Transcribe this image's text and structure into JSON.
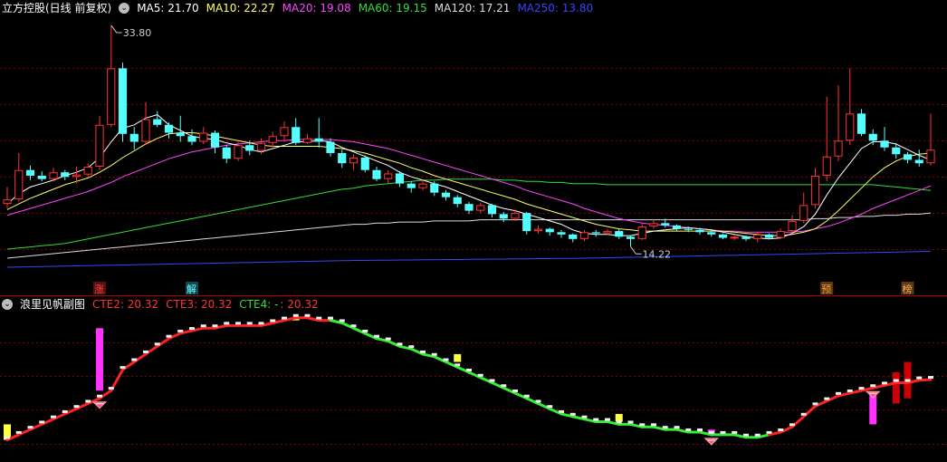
{
  "main_chart": {
    "title": "立方控股(日线 前复权)",
    "indicators": [
      {
        "label": "MA5: 21.70",
        "color": "#ffffff"
      },
      {
        "label": "MA10: 22.27",
        "color": "#ffff66"
      },
      {
        "label": "MA20: 19.08",
        "color": "#ff44ff"
      },
      {
        "label": "MA60: 19.15",
        "color": "#33dd33"
      },
      {
        "label": "MA120: 17.21",
        "color": "#dddddd"
      },
      {
        "label": "MA250: 13.80",
        "color": "#3344ff"
      }
    ],
    "high_label": "33.80",
    "low_label": "14.22",
    "markers": [
      "涨",
      "解",
      "预",
      "榜"
    ]
  },
  "sub_chart": {
    "title": "浪里见帆副图",
    "indicators": [
      {
        "label": "CTE2: 20.32",
        "color": "#ff3333"
      },
      {
        "label": "CTE3: 20.32",
        "color": "#ff3333"
      },
      {
        "label": "CTE4: -",
        "color": "#33dd33"
      },
      {
        "label": ": 20.32",
        "color": "#ff3333"
      }
    ]
  },
  "colors": {
    "up": "#ff3333",
    "down": "#54ffff",
    "grid": "#8b0000",
    "background": "#000000"
  },
  "chart_data": {
    "type": "candlestick",
    "candles": [
      [
        18.0,
        18.4,
        17.6,
        19.5
      ],
      [
        18.4,
        21.0,
        18.2,
        22.5
      ],
      [
        21.0,
        20.5,
        20.1,
        21.4
      ],
      [
        20.5,
        20.2,
        20.0,
        20.9
      ],
      [
        20.2,
        20.8,
        20.0,
        21.2
      ],
      [
        20.8,
        20.4,
        20.1,
        21.0
      ],
      [
        20.4,
        20.6,
        19.8,
        21.3
      ],
      [
        20.6,
        21.3,
        20.4,
        21.6
      ],
      [
        21.3,
        25.0,
        21.0,
        25.8
      ],
      [
        25.0,
        30.0,
        24.8,
        33.8
      ],
      [
        30.0,
        24.2,
        23.5,
        30.5
      ],
      [
        24.2,
        23.5,
        22.8,
        24.8
      ],
      [
        23.5,
        25.5,
        23.2,
        27.0
      ],
      [
        25.5,
        25.0,
        24.8,
        26.2
      ],
      [
        25.0,
        24.3,
        23.8,
        25.2
      ],
      [
        24.3,
        24.0,
        23.5,
        25.8
      ],
      [
        24.0,
        23.5,
        23.2,
        24.6
      ],
      [
        23.5,
        24.3,
        23.3,
        24.8
      ],
      [
        24.3,
        23.0,
        22.5,
        24.5
      ],
      [
        23.0,
        22.0,
        21.6,
        23.2
      ],
      [
        22.0,
        23.2,
        21.8,
        23.5
      ],
      [
        23.2,
        22.7,
        22.3,
        23.6
      ],
      [
        22.7,
        23.4,
        22.4,
        23.8
      ],
      [
        23.4,
        24.0,
        23.0,
        24.4
      ],
      [
        24.0,
        24.8,
        23.5,
        25.3
      ],
      [
        24.8,
        23.4,
        23.2,
        25.6
      ],
      [
        23.4,
        23.8,
        23.3,
        24.2
      ],
      [
        23.8,
        23.5,
        23.0,
        25.6
      ],
      [
        23.5,
        22.5,
        22.2,
        23.8
      ],
      [
        22.5,
        21.6,
        21.2,
        22.8
      ],
      [
        21.6,
        22.1,
        21.0,
        22.4
      ],
      [
        22.1,
        21.0,
        20.8,
        22.3
      ],
      [
        21.0,
        20.2,
        20.0,
        21.3
      ],
      [
        20.2,
        20.7,
        19.8,
        21.0
      ],
      [
        20.7,
        19.8,
        19.5,
        20.9
      ],
      [
        19.8,
        19.4,
        19.0,
        20.0
      ],
      [
        19.4,
        19.8,
        19.2,
        20.1
      ],
      [
        19.8,
        19.0,
        18.7,
        20.0
      ],
      [
        19.0,
        18.6,
        18.3,
        19.2
      ],
      [
        18.6,
        18.0,
        17.7,
        18.8
      ],
      [
        18.0,
        17.4,
        17.1,
        18.2
      ],
      [
        17.4,
        17.9,
        17.2,
        18.1
      ],
      [
        17.9,
        17.1,
        16.8,
        18.0
      ],
      [
        17.1,
        16.7,
        16.4,
        17.3
      ],
      [
        16.7,
        17.2,
        16.5,
        17.5
      ],
      [
        17.2,
        15.6,
        15.3,
        17.3
      ],
      [
        15.6,
        15.8,
        15.4,
        16.1
      ],
      [
        15.8,
        15.5,
        15.2,
        15.9
      ],
      [
        15.5,
        15.3,
        15.0,
        15.7
      ],
      [
        15.3,
        14.9,
        14.6,
        15.4
      ],
      [
        14.9,
        15.5,
        14.7,
        15.7
      ],
      [
        15.5,
        15.4,
        15.1,
        15.7
      ],
      [
        15.4,
        15.6,
        15.3,
        15.8
      ],
      [
        15.6,
        15.1,
        14.9,
        15.8
      ],
      [
        15.1,
        14.9,
        14.22,
        15.2
      ],
      [
        14.9,
        16.0,
        14.8,
        16.3
      ],
      [
        16.0,
        16.3,
        15.8,
        16.6
      ],
      [
        16.3,
        16.1,
        15.9,
        16.7
      ],
      [
        16.1,
        15.8,
        15.6,
        16.2
      ],
      [
        15.8,
        15.7,
        15.5,
        16.0
      ],
      [
        15.7,
        15.5,
        15.3,
        15.9
      ],
      [
        15.5,
        15.3,
        15.1,
        15.7
      ],
      [
        15.3,
        15.0,
        14.9,
        15.4
      ],
      [
        15.0,
        15.1,
        14.8,
        15.3
      ],
      [
        15.1,
        14.9,
        14.7,
        15.2
      ],
      [
        14.9,
        15.3,
        14.6,
        15.5
      ],
      [
        15.3,
        15.0,
        14.9,
        15.4
      ],
      [
        15.0,
        15.6,
        14.9,
        15.8
      ],
      [
        15.6,
        16.5,
        15.4,
        17.0
      ],
      [
        16.5,
        17.9,
        16.3,
        19.0
      ],
      [
        17.9,
        20.5,
        17.6,
        21.2
      ],
      [
        20.5,
        22.2,
        20.0,
        27.5
      ],
      [
        22.2,
        23.6,
        21.8,
        28.5
      ],
      [
        23.6,
        26.0,
        23.2,
        30.0
      ],
      [
        26.0,
        24.2,
        24.0,
        26.4
      ],
      [
        24.2,
        23.6,
        23.2,
        24.6
      ],
      [
        23.6,
        23.0,
        22.7,
        24.8
      ],
      [
        23.0,
        22.4,
        22.0,
        23.4
      ],
      [
        22.4,
        21.9,
        21.6,
        22.6
      ],
      [
        21.9,
        21.6,
        21.3,
        22.8
      ],
      [
        21.6,
        22.8,
        21.4,
        26.0
      ]
    ],
    "ma5": [
      18.0,
      18.9,
      19.5,
      19.8,
      20.1,
      20.5,
      20.8,
      21.2,
      22.1,
      23.5,
      24.7,
      25.0,
      25.6,
      25.9,
      25.0,
      24.5,
      24.0,
      23.8,
      23.7,
      23.4,
      23.2,
      22.8,
      22.6,
      22.9,
      23.2,
      23.5,
      23.5,
      23.6,
      23.5,
      23.0,
      22.6,
      22.2,
      21.8,
      21.4,
      20.8,
      20.4,
      20.1,
      19.8,
      19.5,
      19.1,
      18.7,
      18.3,
      17.9,
      17.6,
      17.4,
      17.1,
      16.8,
      16.5,
      16.2,
      15.7,
      15.4,
      15.3,
      15.3,
      15.2,
      15.2,
      15.4,
      15.6,
      15.7,
      15.8,
      15.9,
      15.8,
      15.7,
      15.5,
      15.3,
      15.1,
      15.0,
      14.9,
      15.0,
      15.4,
      16.0,
      17.1,
      18.8,
      20.3,
      21.6,
      22.9,
      23.5,
      23.5,
      23.3,
      22.8,
      22.3,
      21.9
    ],
    "ma10": [
      17.5,
      18.0,
      18.5,
      18.9,
      19.3,
      19.7,
      20.0,
      20.3,
      20.8,
      21.4,
      22.1,
      22.7,
      23.3,
      23.8,
      24.2,
      24.3,
      24.3,
      24.2,
      24.0,
      23.8,
      23.6,
      23.4,
      23.2,
      23.1,
      23.1,
      23.1,
      23.1,
      23.1,
      23.0,
      22.9,
      22.7,
      22.5,
      22.2,
      21.9,
      21.6,
      21.2,
      20.9,
      20.5,
      20.2,
      19.9,
      19.6,
      19.3,
      19.0,
      18.7,
      18.4,
      18.0,
      17.7,
      17.4,
      17.1,
      16.8,
      16.5,
      16.2,
      16.0,
      15.8,
      15.7,
      15.6,
      15.6,
      15.6,
      15.6,
      15.6,
      15.6,
      15.6,
      15.6,
      15.5,
      15.4,
      15.3,
      15.2,
      15.2,
      15.3,
      15.5,
      15.8,
      16.5,
      17.4,
      18.4,
      19.4,
      20.4,
      21.2,
      21.8,
      22.2,
      22.4,
      22.5
    ],
    "ma20": [
      17.0,
      17.3,
      17.6,
      17.9,
      18.2,
      18.5,
      18.8,
      19.1,
      19.5,
      19.9,
      20.4,
      20.8,
      21.2,
      21.6,
      22.0,
      22.3,
      22.6,
      22.8,
      23.0,
      23.2,
      23.3,
      23.4,
      23.5,
      23.6,
      23.6,
      23.7,
      23.7,
      23.7,
      23.7,
      23.6,
      23.5,
      23.3,
      23.1,
      22.9,
      22.6,
      22.3,
      22.0,
      21.7,
      21.4,
      21.1,
      20.8,
      20.5,
      20.2,
      19.9,
      19.6,
      19.2,
      18.9,
      18.6,
      18.3,
      18.0,
      17.6,
      17.3,
      17.0,
      16.7,
      16.5,
      16.3,
      16.2,
      16.1,
      16.0,
      15.9,
      15.8,
      15.7,
      15.6,
      15.6,
      15.5,
      15.5,
      15.5,
      15.5,
      15.5,
      15.6,
      15.8,
      16.0,
      16.3,
      16.7,
      17.1,
      17.6,
      18.0,
      18.4,
      18.8,
      19.2,
      19.6
    ],
    "ma60": [
      14.0,
      14.1,
      14.2,
      14.3,
      14.4,
      14.5,
      14.7,
      14.9,
      15.1,
      15.3,
      15.5,
      15.7,
      15.9,
      16.1,
      16.3,
      16.5,
      16.7,
      16.9,
      17.1,
      17.3,
      17.5,
      17.7,
      17.9,
      18.1,
      18.3,
      18.5,
      18.7,
      18.9,
      19.1,
      19.3,
      19.4,
      19.6,
      19.7,
      19.8,
      19.9,
      20.0,
      20.1,
      20.1,
      20.2,
      20.2,
      20.2,
      20.2,
      20.2,
      20.1,
      20.1,
      20.0,
      20.0,
      19.9,
      19.9,
      19.8,
      19.8,
      19.8,
      19.7,
      19.7,
      19.7,
      19.7,
      19.7,
      19.7,
      19.7,
      19.7,
      19.7,
      19.7,
      19.7,
      19.7,
      19.7,
      19.7,
      19.7,
      19.7,
      19.7,
      19.7,
      19.7,
      19.7,
      19.7,
      19.7,
      19.7,
      19.7,
      19.6,
      19.5,
      19.4,
      19.3,
      19.2
    ],
    "ma120": [
      13.2,
      13.3,
      13.4,
      13.5,
      13.6,
      13.7,
      13.8,
      13.9,
      14.0,
      14.1,
      14.2,
      14.3,
      14.4,
      14.5,
      14.6,
      14.7,
      14.8,
      14.9,
      15.0,
      15.1,
      15.2,
      15.3,
      15.4,
      15.5,
      15.6,
      15.7,
      15.8,
      15.9,
      16.0,
      16.1,
      16.2,
      16.2,
      16.3,
      16.3,
      16.4,
      16.4,
      16.4,
      16.5,
      16.5,
      16.5,
      16.5,
      16.6,
      16.6,
      16.6,
      16.6,
      16.6,
      16.6,
      16.6,
      16.6,
      16.6,
      16.6,
      16.6,
      16.6,
      16.6,
      16.6,
      16.6,
      16.6,
      16.6,
      16.6,
      16.6,
      16.6,
      16.6,
      16.6,
      16.6,
      16.6,
      16.6,
      16.6,
      16.6,
      16.6,
      16.6,
      16.7,
      16.7,
      16.8,
      16.8,
      16.9,
      16.9,
      17.0,
      17.0,
      17.1,
      17.1,
      17.2
    ],
    "ma250": [
      12.4,
      12.42,
      12.44,
      12.46,
      12.48,
      12.5,
      12.52,
      12.54,
      12.56,
      12.58,
      12.6,
      12.62,
      12.64,
      12.66,
      12.68,
      12.7,
      12.72,
      12.74,
      12.76,
      12.78,
      12.8,
      12.82,
      12.84,
      12.86,
      12.88,
      12.9,
      12.92,
      12.94,
      12.96,
      12.98,
      13.0,
      13.0,
      13.02,
      13.02,
      13.04,
      13.04,
      13.06,
      13.06,
      13.08,
      13.08,
      13.1,
      13.1,
      13.12,
      13.12,
      13.14,
      13.14,
      13.16,
      13.16,
      13.18,
      13.18,
      13.2,
      13.22,
      13.24,
      13.26,
      13.28,
      13.3,
      13.32,
      13.34,
      13.36,
      13.38,
      13.4,
      13.42,
      13.44,
      13.46,
      13.48,
      13.5,
      13.52,
      13.54,
      13.56,
      13.58,
      13.6,
      13.62,
      13.64,
      13.66,
      13.68,
      13.7,
      13.72,
      13.74,
      13.76,
      13.78,
      13.8
    ],
    "sub_line": [
      18.0,
      18.2,
      18.4,
      18.6,
      18.8,
      19.0,
      19.2,
      19.4,
      19.6,
      19.9,
      20.7,
      21.0,
      21.3,
      21.6,
      21.9,
      22.1,
      22.2,
      22.3,
      22.3,
      22.4,
      22.4,
      22.4,
      22.4,
      22.5,
      22.6,
      22.7,
      22.7,
      22.6,
      22.6,
      22.5,
      22.3,
      22.1,
      21.9,
      21.8,
      21.6,
      21.5,
      21.3,
      21.2,
      21.0,
      20.8,
      20.6,
      20.4,
      20.2,
      20.0,
      19.8,
      19.6,
      19.4,
      19.2,
      19.0,
      18.9,
      18.8,
      18.7,
      18.7,
      18.6,
      18.6,
      18.5,
      18.5,
      18.4,
      18.4,
      18.3,
      18.3,
      18.2,
      18.2,
      18.2,
      18.1,
      18.1,
      18.2,
      18.3,
      18.5,
      18.9,
      19.3,
      19.5,
      19.7,
      19.8,
      19.9,
      20.0,
      20.1,
      20.2,
      20.2,
      20.3,
      20.32
    ],
    "sub_colors": [
      "r",
      "r",
      "r",
      "r",
      "r",
      "r",
      "r",
      "r",
      "r",
      "r",
      "r",
      "r",
      "r",
      "r",
      "r",
      "r",
      "r",
      "r",
      "r",
      "r",
      "r",
      "r",
      "r",
      "r",
      "r",
      "r",
      "r",
      "r",
      "g",
      "g",
      "g",
      "g",
      "g",
      "g",
      "g",
      "g",
      "g",
      "g",
      "g",
      "g",
      "g",
      "g",
      "g",
      "g",
      "g",
      "g",
      "g",
      "g",
      "g",
      "g",
      "g",
      "g",
      "g",
      "g",
      "g",
      "g",
      "g",
      "g",
      "g",
      "g",
      "g",
      "g",
      "g",
      "g",
      "g",
      "g",
      "r",
      "r",
      "r",
      "r",
      "r",
      "r",
      "r",
      "r",
      "r",
      "r",
      "r",
      "r",
      "r",
      "r",
      "r"
    ],
    "sub_bars": [
      {
        "i": 0,
        "from": 18.0,
        "to": 18.6,
        "color": "#ffff44"
      },
      {
        "i": 8,
        "from": 19.9,
        "to": 22.3,
        "color": "#ff33ff"
      },
      {
        "i": 25,
        "from": 22.6,
        "to": 22.7,
        "color": "#ffff44"
      },
      {
        "i": 39,
        "from": 21.0,
        "to": 21.3,
        "color": "#ffff44"
      },
      {
        "i": 53,
        "from": 18.7,
        "to": 19.0,
        "color": "#ffff44"
      },
      {
        "i": 61,
        "from": 18.2,
        "to": 18.4,
        "color": "#ff33ff"
      },
      {
        "i": 75,
        "from": 18.6,
        "to": 19.8,
        "color": "#ff33ff"
      },
      {
        "i": 77,
        "from": 19.4,
        "to": 20.6,
        "color": "#cc0000"
      },
      {
        "i": 78,
        "from": 19.6,
        "to": 21.0,
        "color": "#cc0000"
      }
    ],
    "sub_signals": [
      8,
      61,
      75
    ],
    "marker_index": [
      8,
      16,
      71,
      78
    ]
  }
}
